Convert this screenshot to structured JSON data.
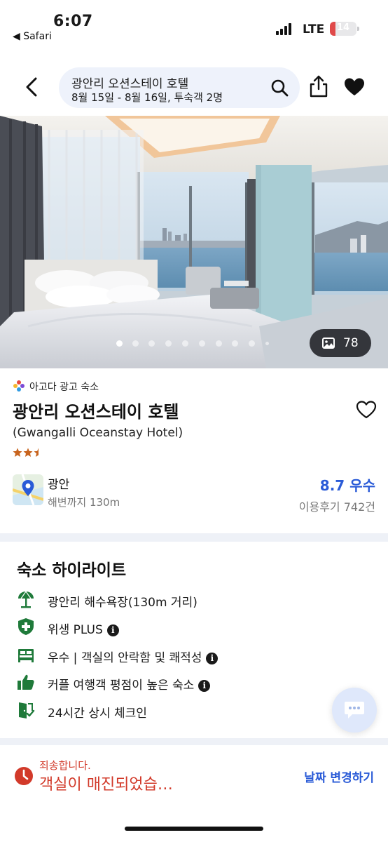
{
  "status_bar": {
    "time": "6:07",
    "back_app": "◀ Safari",
    "network": "LTE",
    "battery": "14",
    "battery_color": "#e04a4a"
  },
  "nav": {
    "title": "광안리 오션스테이 호텔",
    "subtitle": "8월 15일 - 8월 16일, 투숙객 2명",
    "icons": [
      "chevron-left-icon",
      "search-icon",
      "share-icon",
      "heart-icon"
    ]
  },
  "gallery": {
    "photo_count": "78",
    "dot_count": 10,
    "active_dot": 0
  },
  "hotel": {
    "ad_label": "아고다 광고 숙소",
    "name": "광안리 오션스테이 호텔",
    "name_en": "(Gwangalli Oceanstay Hotel)",
    "star_rating": 2.5,
    "star_color": "#c8641e",
    "location": "광안",
    "location_detail": "해변까지 130m",
    "score": "8.7 우수",
    "reviews": "이용후기 742건",
    "accent_color": "#2a5bd7"
  },
  "highlights": {
    "title": "숙소 하이라이트",
    "items": [
      {
        "icon": "beach-umbrella-icon",
        "label": "광안리 해수욕장(130m 거리)",
        "info": false
      },
      {
        "icon": "shield-plus-icon",
        "label": "위생 PLUS",
        "info": true
      },
      {
        "icon": "bed-icon",
        "label": "우수 | 객실의 안락함 및 쾌적성",
        "info": true
      },
      {
        "icon": "thumbs-up-icon",
        "label": "커플 여행객 평점이 높은 숙소",
        "info": true
      },
      {
        "icon": "door-check-icon",
        "label": "24시간 상시 체크인",
        "info": false
      }
    ],
    "icon_color": "#1f7a3a"
  },
  "bottom_bar": {
    "sorry": "죄송합니다.",
    "message": "객실이 매진되었습…",
    "action": "날짜 변경하기",
    "alert_color": "#d23a2a"
  }
}
